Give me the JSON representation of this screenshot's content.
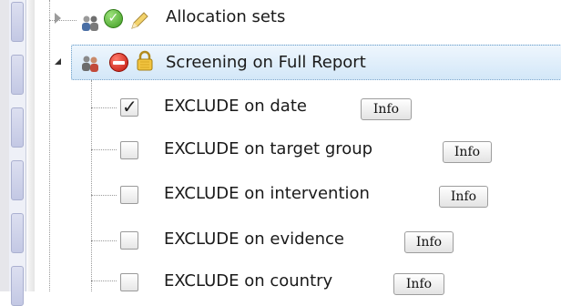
{
  "tree": {
    "allocation_row": {
      "label": "Allocation sets",
      "icons": [
        "people-icon",
        "check-circle-icon",
        "pencil-icon"
      ]
    },
    "screening_row": {
      "label": "Screening on Full Report",
      "icons": [
        "people-icon",
        "no-entry-icon",
        "lock-icon"
      ],
      "expanded": true,
      "selected": true
    },
    "criteria": [
      {
        "label": "EXCLUDE on date",
        "checked": true,
        "info_label": "Info"
      },
      {
        "label": "EXCLUDE on target group",
        "checked": false,
        "info_label": "Info"
      },
      {
        "label": "EXCLUDE on intervention",
        "checked": false,
        "info_label": "Info"
      },
      {
        "label": "EXCLUDE on evidence",
        "checked": false,
        "info_label": "Info"
      },
      {
        "label": "EXCLUDE on country",
        "checked": false,
        "info_label": "Info"
      }
    ]
  },
  "colors": {
    "selection_fill": "#d3e7f8",
    "selection_border": "#6c9ec8",
    "check_green": "#3f9b22",
    "no_entry_red": "#c0150b"
  }
}
